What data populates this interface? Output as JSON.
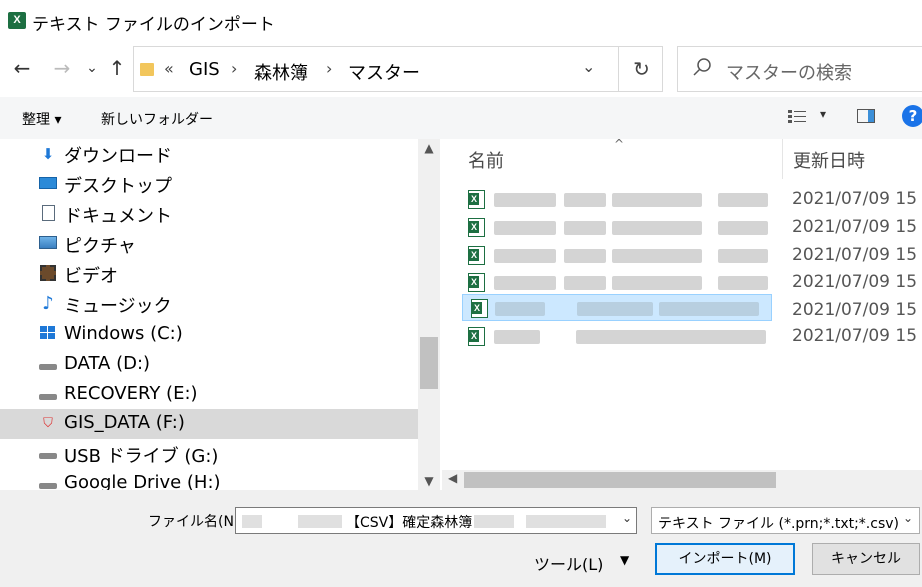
{
  "window": {
    "title": "テキスト ファイルのインポート",
    "app_icon": "excel-icon"
  },
  "nav": {
    "back": "←",
    "forward": "→",
    "recent": "⌄",
    "up": "↑",
    "overflow": "«",
    "breadcrumb": [
      "GIS",
      "森林簿",
      "マスター"
    ],
    "search_placeholder": "マスターの検索"
  },
  "toolbar": {
    "organize": "整理 ▾",
    "new_folder": "新しいフォルダー"
  },
  "tree": [
    {
      "label": "ダウンロード",
      "icon": "download-icon"
    },
    {
      "label": "デスクトップ",
      "icon": "desktop-icon"
    },
    {
      "label": "ドキュメント",
      "icon": "documents-icon"
    },
    {
      "label": "ピクチャ",
      "icon": "pictures-icon"
    },
    {
      "label": "ビデオ",
      "icon": "video-icon"
    },
    {
      "label": "ミュージック",
      "icon": "music-icon"
    },
    {
      "label": "Windows (C:)",
      "icon": "windows-drive-icon"
    },
    {
      "label": "DATA (D:)",
      "icon": "drive-icon"
    },
    {
      "label": "RECOVERY (E:)",
      "icon": "drive-icon"
    },
    {
      "label": "GIS_DATA (F:)",
      "icon": "secure-drive-icon"
    },
    {
      "label": "USB ドライブ (G:)",
      "icon": "usb-drive-icon"
    },
    {
      "label": "Google Drive (H:)",
      "icon": "drive-icon"
    }
  ],
  "columns": {
    "name": "名前",
    "modified": "更新日時"
  },
  "files": [
    {
      "date": "2021/07/09 15"
    },
    {
      "date": "2021/07/09 15"
    },
    {
      "date": "2021/07/09 15"
    },
    {
      "date": "2021/07/09 15"
    },
    {
      "date": "2021/07/09 15"
    },
    {
      "date": "2021/07/09 15"
    }
  ],
  "footer": {
    "filename_label": "ファイル名(N):",
    "filename_value": "【CSV】確定森林簿",
    "filetype": "テキスト ファイル (*.prn;*.txt;*.csv)",
    "tools": "ツール(L)",
    "import": "インポート(M)",
    "cancel": "キャンセル"
  }
}
